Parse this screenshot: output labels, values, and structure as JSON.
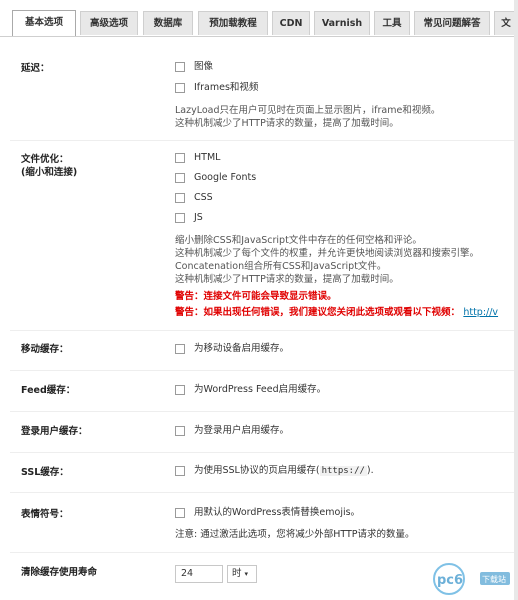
{
  "tabs": [
    {
      "label": "基本选项",
      "active": true
    },
    {
      "label": "高级选项"
    },
    {
      "label": "数据库"
    },
    {
      "label": "预加载教程"
    },
    {
      "label": "CDN"
    },
    {
      "label": "Varnish"
    },
    {
      "label": "工具"
    },
    {
      "label": "常见问题解答"
    },
    {
      "label": "文"
    }
  ],
  "lazyload": {
    "label": "延迟：",
    "options": [
      "图像",
      "Iframes和视频"
    ],
    "desc": [
      "LazyLoad只在用户可见时在页面上显示图片，iframe和视频。",
      "这种机制减少了HTTP请求的数量，提高了加载时间。"
    ]
  },
  "minify": {
    "label": "文件优化：",
    "label2": "(缩小和连接)",
    "options": [
      "HTML",
      "Google Fonts",
      "CSS",
      "JS"
    ],
    "desc": [
      "缩小删除CSS和JavaScript文件中存在的任何空格和评论。",
      "这种机制减少了每个文件的权重，并允许更快地阅读浏览器和搜索引擎。",
      "Concatenation组合所有CSS和JavaScript文件。",
      "这种机制减少了HTTP请求的数量，提高了加载时间。"
    ],
    "warning1": "警告：连接文件可能会导致显示错误。",
    "warning2": "警告：如果出现任何错误，我们建议您关闭此选项或观看以下视频：",
    "warning2_link": "http://v"
  },
  "mobile": {
    "label": "移动缓存：",
    "option": "为移动设备启用缓存。"
  },
  "feed": {
    "label": "Feed缓存：",
    "option": "为WordPress Feed启用缓存。"
  },
  "logged": {
    "label": "登录用户缓存：",
    "option": "为登录用户启用缓存。"
  },
  "ssl": {
    "label": "SSL缓存：",
    "option_pre": "为使用SSL协议的页启用缓存(",
    "option_code": "https://",
    "option_post": ")."
  },
  "emoji": {
    "label": "表情符号：",
    "option": "用默认的WordPress表情替换emojis。",
    "note": "注意: 通过激活此选项，您将减少外部HTTP请求的数量。"
  },
  "purge": {
    "label": "清除缓存使用寿命",
    "value": "24",
    "unit": "时"
  },
  "watermark": {
    "text": "pc6",
    "sub": "下载站"
  },
  "colors": {
    "warning": "#e00000",
    "link": "#0073aa"
  }
}
